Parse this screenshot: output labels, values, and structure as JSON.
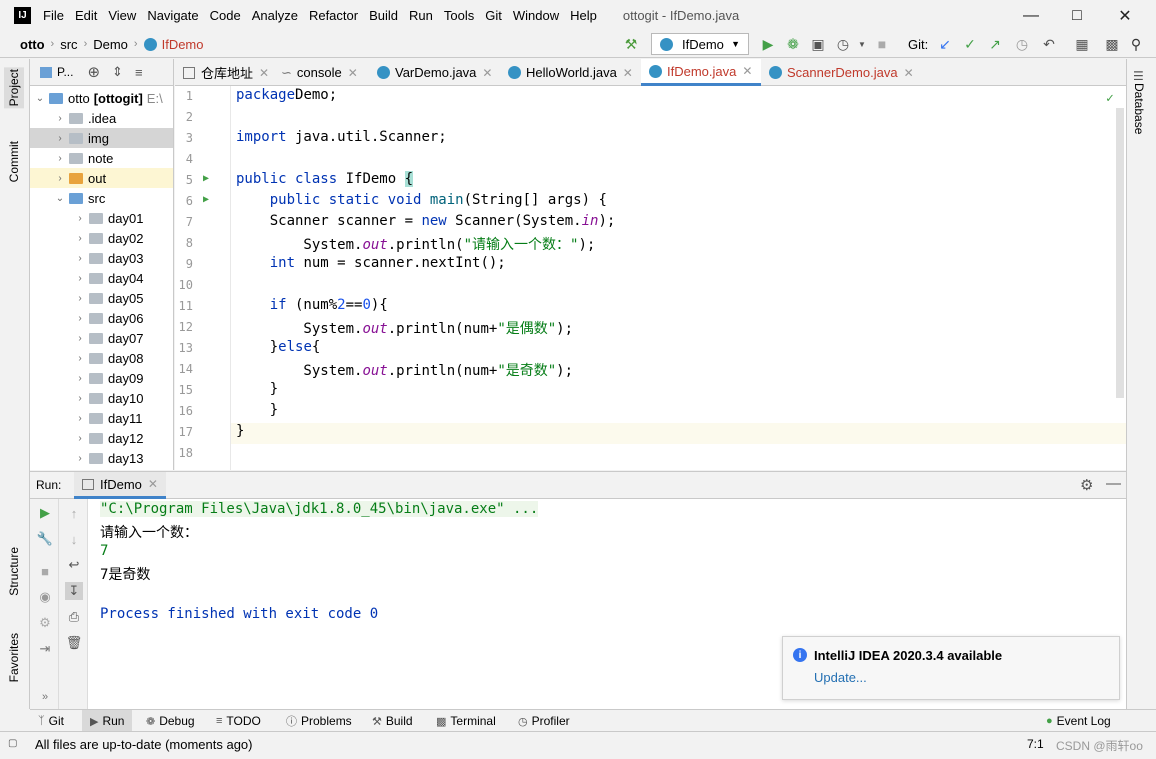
{
  "menubar": {
    "items": [
      "File",
      "Edit",
      "View",
      "Navigate",
      "Code",
      "Analyze",
      "Refactor",
      "Build",
      "Run",
      "Tools",
      "Git",
      "Window",
      "Help"
    ],
    "title": "ottogit - IfDemo.java"
  },
  "navbar": {
    "crumbs": [
      "otto",
      "src",
      "Demo",
      "IfDemo"
    ],
    "run_config": "IfDemo",
    "git_label": "Git:"
  },
  "left_stripe": {
    "project": "Project",
    "commit": "Commit",
    "structure": "Structure",
    "favorites": "Favorites"
  },
  "right_stripe": {
    "database": "Database"
  },
  "project": {
    "header": "P...",
    "root": "otto",
    "root_bold": "[ottogit]",
    "root_path": "E:\\",
    "items": [
      {
        "label": ".idea",
        "level": 1
      },
      {
        "label": "img",
        "level": 1
      },
      {
        "label": "note",
        "level": 1
      },
      {
        "label": "out",
        "level": 1
      },
      {
        "label": "src",
        "level": 1
      },
      {
        "label": "day01",
        "level": 2
      },
      {
        "label": "day02",
        "level": 2
      },
      {
        "label": "day03",
        "level": 2
      },
      {
        "label": "day04",
        "level": 2
      },
      {
        "label": "day05",
        "level": 2
      },
      {
        "label": "day06",
        "level": 2
      },
      {
        "label": "day07",
        "level": 2
      },
      {
        "label": "day08",
        "level": 2
      },
      {
        "label": "day09",
        "level": 2
      },
      {
        "label": "day10",
        "level": 2
      },
      {
        "label": "day11",
        "level": 2
      },
      {
        "label": "day12",
        "level": 2
      },
      {
        "label": "day13",
        "level": 2
      }
    ]
  },
  "editor_tabs": [
    "仓库地址",
    "console",
    "VarDemo.java",
    "HelloWorld.java",
    "IfDemo.java",
    "ScannerDemo.java"
  ],
  "editor": {
    "line_numbers": [
      "1",
      "2",
      "3",
      "4",
      "5",
      "6",
      "7",
      "8",
      "9",
      "10",
      "11",
      "12",
      "13",
      "14",
      "15",
      "16",
      "17",
      "18"
    ],
    "lines": [
      [
        [
          "kw",
          "package"
        ],
        [
          "",
          "Demo;"
        ]
      ],
      [],
      [
        [
          "kw",
          "import"
        ],
        [
          "",
          " java.util.Scanner;"
        ]
      ],
      [],
      [
        [
          "kw",
          "public class"
        ],
        [
          "",
          " IfDemo "
        ],
        [
          "",
          "{"
        ]
      ],
      [
        [
          "",
          "    "
        ],
        [
          "kw",
          "public static void"
        ],
        [
          "",
          " "
        ],
        [
          "fn",
          "main"
        ],
        [
          "",
          "(String[] args) {"
        ]
      ],
      [
        [
          "",
          "    Scanner scanner = "
        ],
        [
          "kw",
          "new"
        ],
        [
          "",
          " Scanner(System."
        ],
        [
          "fld",
          "in"
        ],
        [
          "",
          ");"
        ]
      ],
      [
        [
          "",
          "        System."
        ],
        [
          "fld",
          "out"
        ],
        [
          "",
          ".println("
        ],
        [
          "str",
          "\"请输入一个数：\""
        ],
        [
          "",
          ");"
        ]
      ],
      [
        [
          "",
          "    "
        ],
        [
          "kw",
          "int"
        ],
        [
          "",
          " num = scanner.nextInt();"
        ]
      ],
      [],
      [
        [
          "",
          "    "
        ],
        [
          "kw",
          "if"
        ],
        [
          "",
          " (num%"
        ],
        [
          "num",
          "2"
        ],
        [
          "",
          "=="
        ],
        [
          "num",
          "0"
        ],
        [
          "",
          ")"
        ],
        [
          "",
          "{"
        ]
      ],
      [
        [
          "",
          "        System."
        ],
        [
          "fld",
          "out"
        ],
        [
          "",
          ".println(num+"
        ],
        [
          "str",
          "\"是偶数\""
        ],
        [
          "",
          ");"
        ]
      ],
      [
        [
          "",
          "    }"
        ],
        [
          "kw",
          "else"
        ],
        [
          "",
          "{"
        ]
      ],
      [
        [
          "",
          "        System."
        ],
        [
          "fld",
          "out"
        ],
        [
          "",
          ".println(num+"
        ],
        [
          "str",
          "\"是奇数\""
        ],
        [
          "",
          ");"
        ]
      ],
      [
        [
          "",
          "    }"
        ]
      ],
      [
        [
          "",
          "    }"
        ]
      ],
      [
        [
          "",
          "}"
        ]
      ],
      []
    ]
  },
  "run": {
    "label": "Run:",
    "tab": "IfDemo",
    "output": [
      "\"C:\\Program Files\\Java\\jdk1.8.0_45\\bin\\java.exe\" ...",
      "请输入一个数：",
      "7",
      "7是奇数",
      "",
      "Process finished with exit code 0"
    ]
  },
  "notification": {
    "title": "IntelliJ IDEA 2020.3.4 available",
    "link": "Update..."
  },
  "tool_bar": [
    "Git",
    "Run",
    "Debug",
    "TODO",
    "Problems",
    "Build",
    "Terminal",
    "Profiler",
    "Event Log"
  ],
  "status": {
    "message": "All files are up-to-date (moments ago)",
    "position": "7:1",
    "watermark": "CSDN @雨轩oo"
  }
}
